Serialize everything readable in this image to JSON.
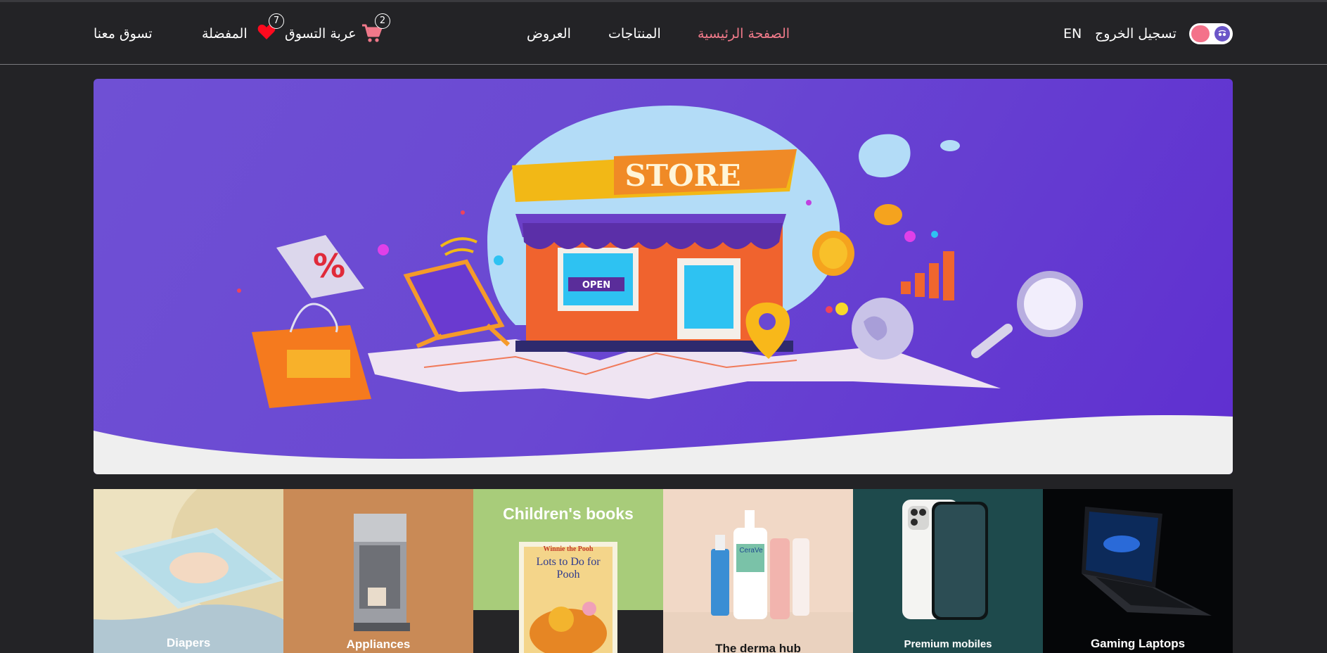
{
  "nav": {
    "shop_with_us": "تسوق معنا",
    "favorites": {
      "label": "المفضلة",
      "count": "7"
    },
    "cart": {
      "label": "عربة التسوق",
      "count": "2"
    },
    "links": [
      "العروض",
      "المنتاجات",
      "الصفحة الرئيسية"
    ],
    "active_link": "الصفحة الرئيسية",
    "language": "EN",
    "logout": "تسجيل الخروج"
  },
  "hero": {
    "sign_text": "STORE",
    "door_sign": "OPEN"
  },
  "categories": [
    {
      "label": "Diapers"
    },
    {
      "label": "Appliances"
    },
    {
      "label": "",
      "banner_text": "Children's books",
      "book_title": "Lots to Do for Pooh",
      "book_brand": "Winnie the Pooh"
    },
    {
      "label": "The derma hub",
      "product_brand": "CeraVe"
    },
    {
      "label": "Premium mobiles"
    },
    {
      "label": "Gaming Laptops"
    }
  ],
  "colors": {
    "background": "#232326",
    "accent": "#f07a8a",
    "hero_purple": "#6a48d2"
  }
}
